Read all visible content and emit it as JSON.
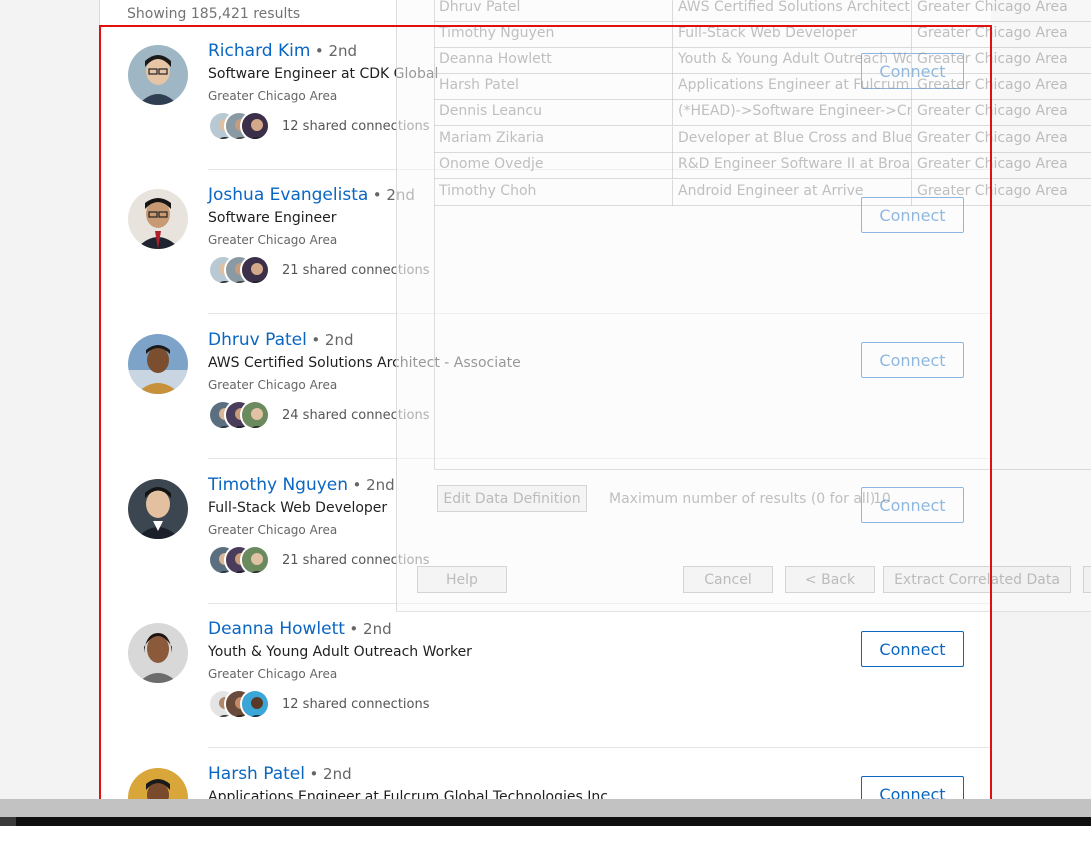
{
  "header": {
    "results_count": "Showing 185,421 results"
  },
  "results": [
    {
      "name": "Richard Kim",
      "degree": "• 2nd",
      "headline": "Software Engineer at CDK Global",
      "location": "Greater Chicago Area",
      "shared": "12 shared connections",
      "connect": "Connect"
    },
    {
      "name": "Joshua Evangelista",
      "degree": "• 2nd",
      "headline": "Software Engineer",
      "location": "Greater Chicago Area",
      "shared": "21 shared connections",
      "connect": "Connect"
    },
    {
      "name": "Dhruv Patel",
      "degree": "• 2nd",
      "headline": "AWS Certified Solutions Architect - Associate",
      "location": "Greater Chicago Area",
      "shared": "24 shared connections",
      "connect": "Connect"
    },
    {
      "name": "Timothy Nguyen",
      "degree": "• 2nd",
      "headline": "Full-Stack Web Developer",
      "location": "Greater Chicago Area",
      "shared": "21 shared connections",
      "connect": "Connect"
    },
    {
      "name": "Deanna Howlett",
      "degree": "• 2nd",
      "headline": "Youth & Young Adult Outreach Worker",
      "location": "Greater Chicago Area",
      "shared": "12 shared connections",
      "connect": "Connect"
    },
    {
      "name": "Harsh Patel",
      "degree": "• 2nd",
      "headline": "Applications Engineer at Fulcrum Global Technologies Inc",
      "location": "Greater Chicago Area",
      "shared": "",
      "connect": "Connect"
    }
  ],
  "ghost_dialog": {
    "rows": [
      [
        "Dhruv Patel",
        "AWS Certified Solutions Architect - A",
        "Greater Chicago Area"
      ],
      [
        "Timothy Nguyen",
        "Full-Stack Web Developer",
        "Greater Chicago Area"
      ],
      [
        "Deanna Howlett",
        "Youth & Young Adult Outreach Wor",
        "Greater Chicago Area"
      ],
      [
        "Harsh Patel",
        "Applications Engineer at Fulcrum Gl",
        "Greater Chicago Area"
      ],
      [
        "Dennis Leancu",
        "(*HEAD)->Software Engineer->Cryp",
        "Greater Chicago Area"
      ],
      [
        "Mariam Zikaria",
        "Developer at Blue Cross and Blue Sh",
        "Greater Chicago Area"
      ],
      [
        "Onome Ovedje",
        "R&D Engineer Software II at Broadc",
        "Greater Chicago Area"
      ],
      [
        "Timothy Choh",
        "Android Engineer at Arrive",
        "Greater Chicago Area"
      ]
    ],
    "edit_button": "Edit Data Definition",
    "max_results_label": "Maximum number of results (0 for all)",
    "max_results_value": "10",
    "help_button": "Help",
    "cancel_button": "Cancel",
    "back_button": "< Back",
    "extract_button": "Extract Correlated Data"
  },
  "colors": {
    "link": "#0a66c2",
    "selection": "#e01010"
  }
}
